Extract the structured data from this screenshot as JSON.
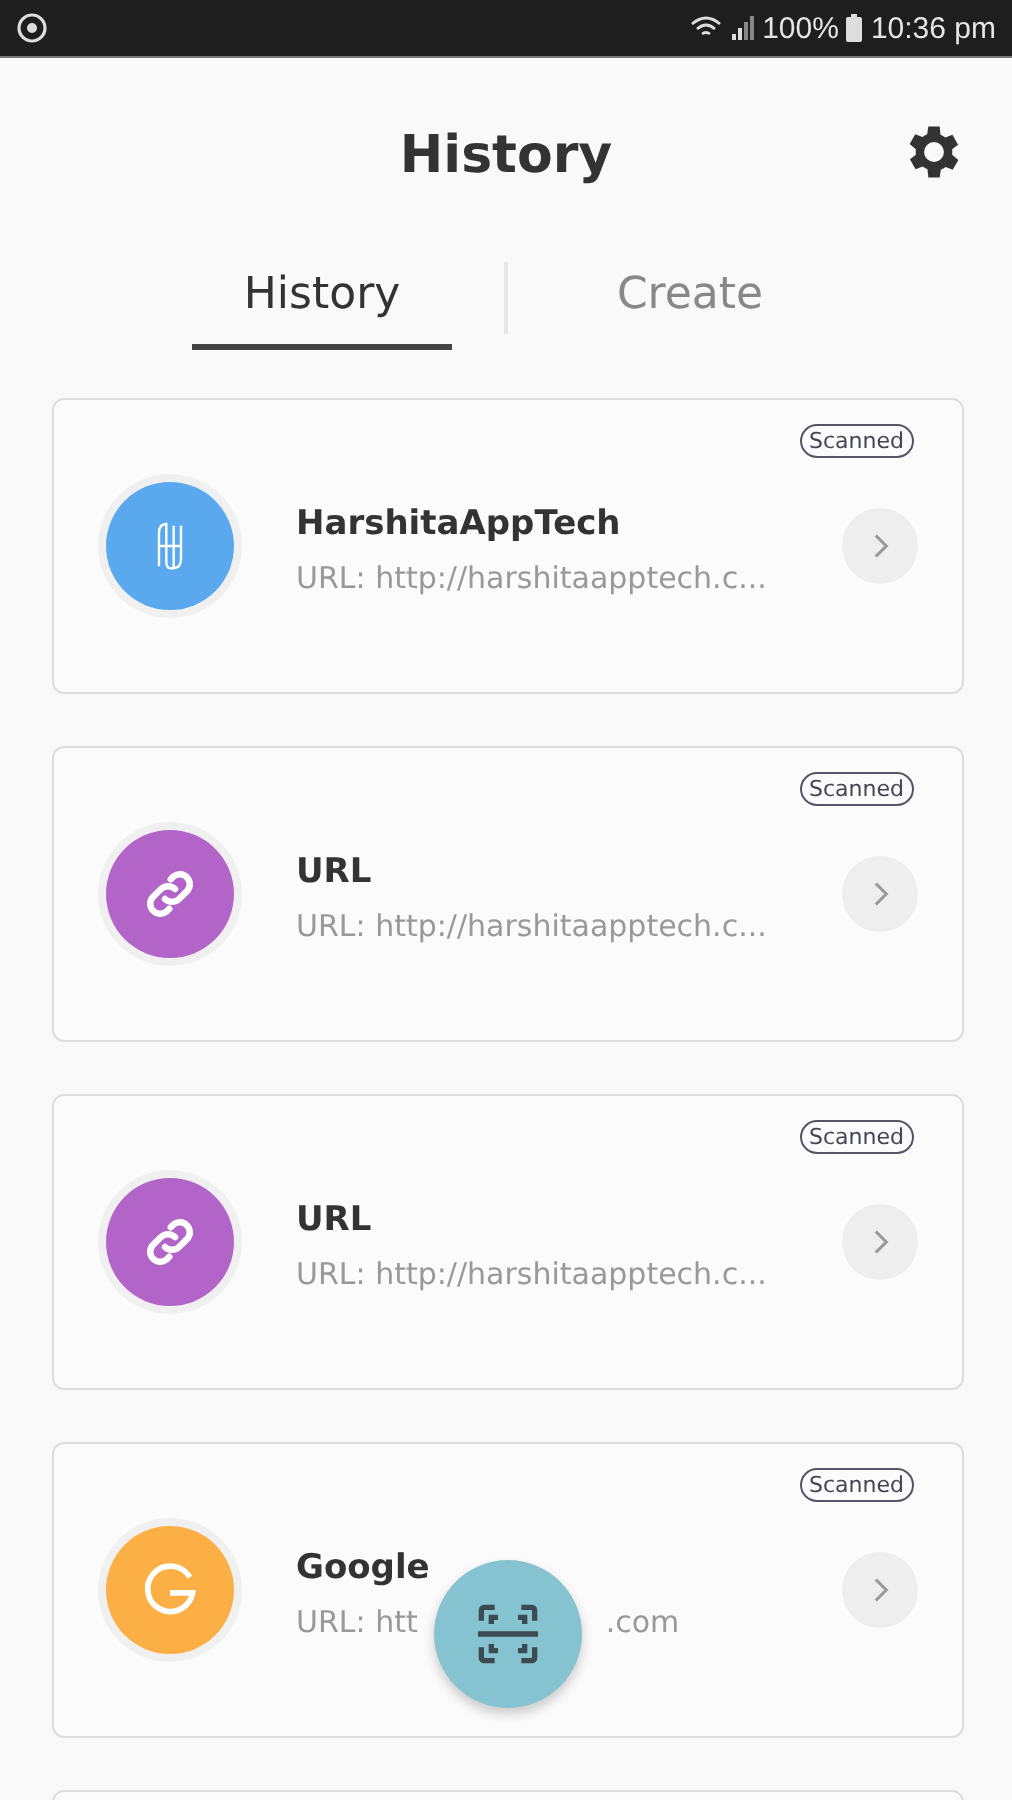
{
  "status_bar": {
    "battery": "100%",
    "time": "10:36 pm"
  },
  "header": {
    "title": "History"
  },
  "tabs": [
    {
      "label": "History",
      "selected": true
    },
    {
      "label": "Create",
      "selected": false
    }
  ],
  "items": [
    {
      "kind": "logo",
      "title": "HarshitaAppTech",
      "url": [
        "URL: http://harshitaapptech.c..."
      ],
      "badge": "Scanned",
      "color": "#5aa9ef"
    },
    {
      "kind": "link",
      "title": "URL",
      "url": [
        "URL: http://harshitaapptech.c..."
      ],
      "badge": "Scanned",
      "color": "#b264c9"
    },
    {
      "kind": "link",
      "title": "URL",
      "url": [
        "URL: http://harshitaapptech.c..."
      ],
      "badge": "Scanned",
      "color": "#b264c9"
    },
    {
      "kind": "letter",
      "title": "Google",
      "url": [
        "URL: htt",
        ".com"
      ],
      "badge": "Scanned",
      "color": "#fcaf45"
    },
    {
      "kind": "partial"
    }
  ]
}
